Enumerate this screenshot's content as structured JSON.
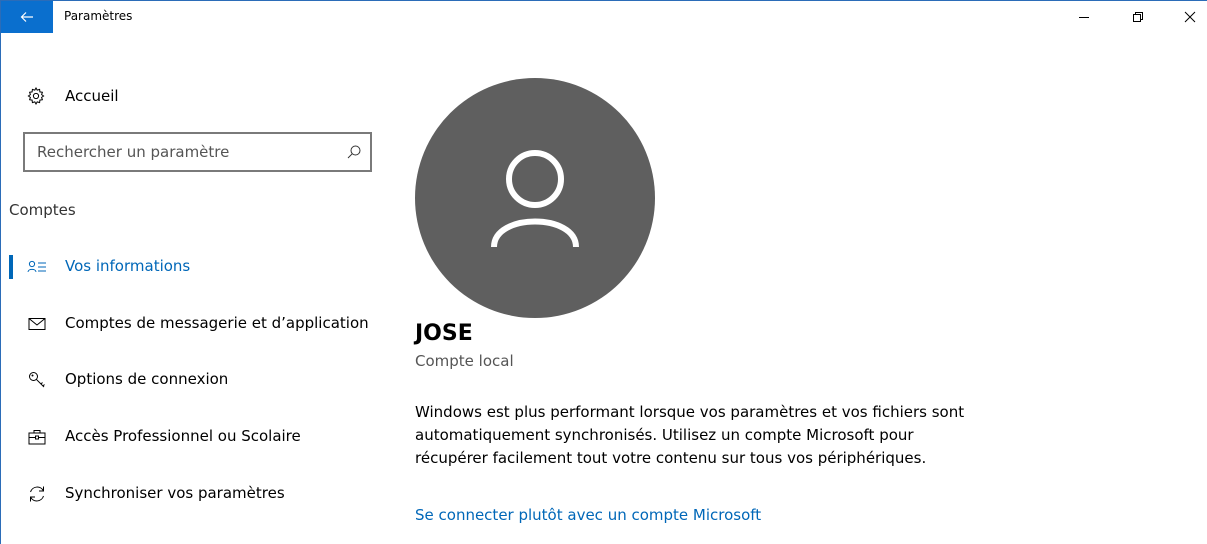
{
  "window": {
    "title": "Paramètres"
  },
  "sidebar": {
    "home_label": "Accueil",
    "search_placeholder": "Rechercher un paramètre",
    "section_title": "Comptes",
    "items": [
      {
        "label": "Vos informations",
        "icon": "person-list-icon",
        "active": true
      },
      {
        "label": "Comptes de messagerie et d’application",
        "icon": "mail-icon",
        "active": false
      },
      {
        "label": "Options de connexion",
        "icon": "key-icon",
        "active": false
      },
      {
        "label": "Accès Professionnel ou Scolaire",
        "icon": "briefcase-icon",
        "active": false
      },
      {
        "label": "Synchroniser vos paramètres",
        "icon": "sync-icon",
        "active": false
      }
    ]
  },
  "main": {
    "user_name": "JOSE",
    "account_type": "Compte local",
    "info_text": "Windows est plus performant lorsque vos paramètres et vos fichiers sont automatiquement synchronisés. Utilisez un compte Microsoft pour récupérer facilement tout votre contenu sur tous vos périphériques.",
    "link_label": "Se connecter plutôt avec un compte Microsoft"
  },
  "colors": {
    "accent": "#0067b8",
    "back_button": "#0a6fce",
    "avatar_bg": "#5f5f5f"
  }
}
